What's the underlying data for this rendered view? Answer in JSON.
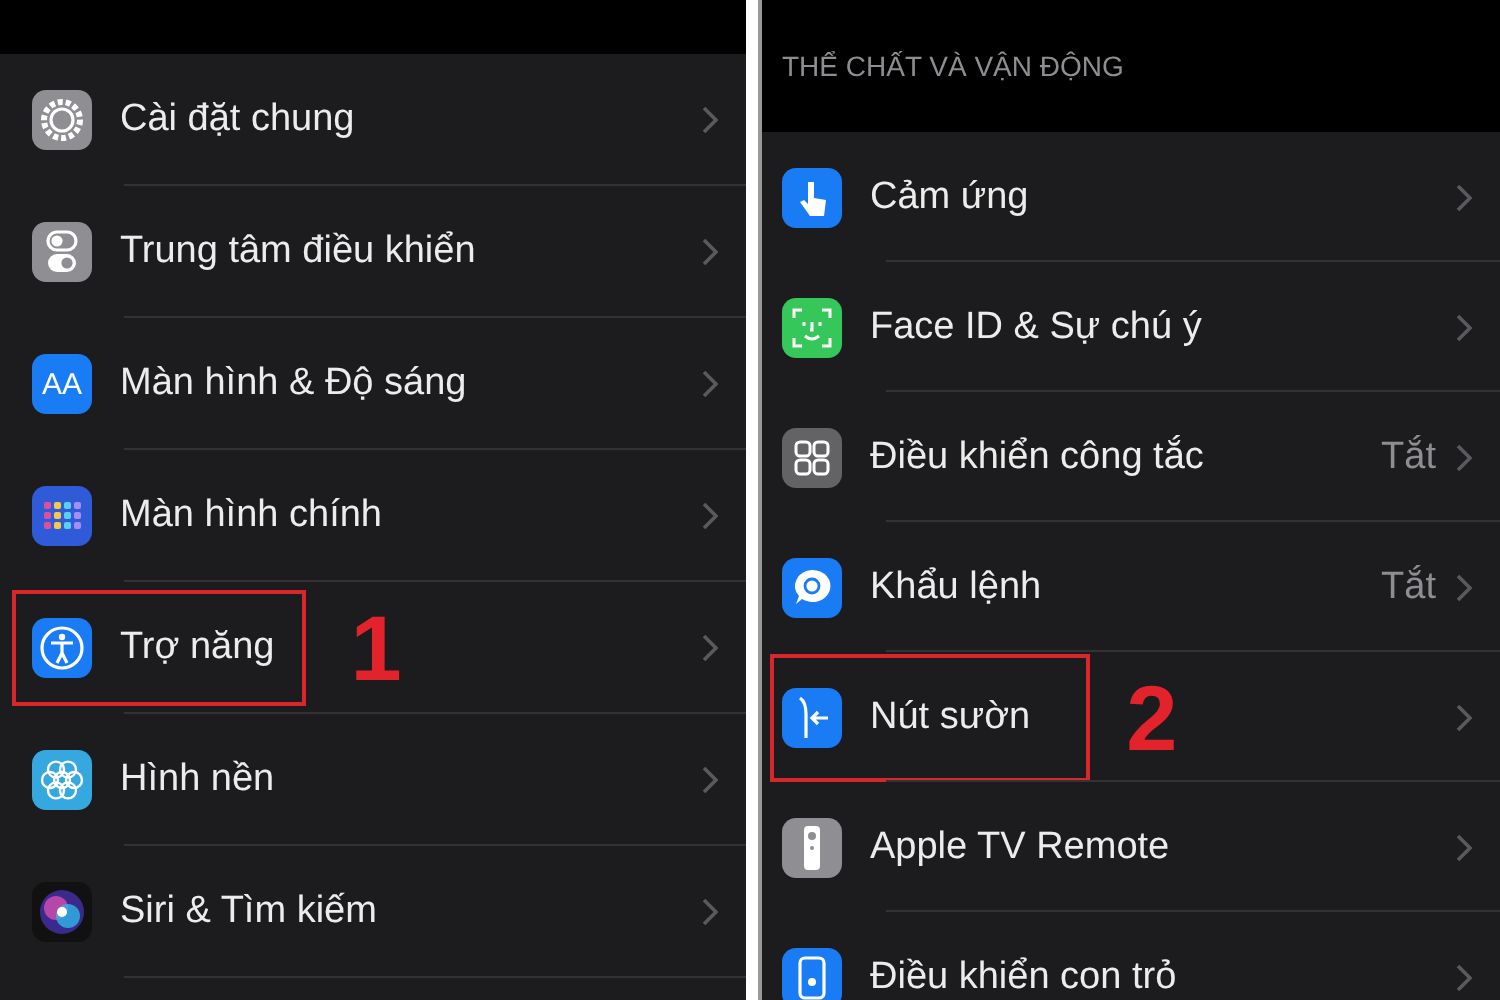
{
  "panels": [
    {
      "rows": [
        {
          "kind": "gear",
          "label": "Cài đặt chung",
          "highlighted": false
        },
        {
          "kind": "toggles",
          "label": "Trung tâm điều khiển",
          "highlighted": false
        },
        {
          "kind": "display",
          "icon_text": "AA",
          "label": "Màn hình & Độ sáng",
          "highlighted": false
        },
        {
          "kind": "grid",
          "label": "Màn hình chính",
          "highlighted": false
        },
        {
          "kind": "accessibility",
          "label": "Trợ năng",
          "highlighted": true,
          "marker": "1"
        },
        {
          "kind": "flower",
          "label": "Hình nền",
          "highlighted": false
        },
        {
          "kind": "orb",
          "label": "Siri & Tìm kiếm",
          "highlighted": false
        }
      ]
    },
    {
      "section_header": "THỂ CHẤT VÀ VẬN ĐỘNG",
      "rows": [
        {
          "kind": "hand",
          "label": "Cảm ứng",
          "highlighted": false
        },
        {
          "kind": "face",
          "label": "Face ID & Sự chú ý",
          "highlighted": false
        },
        {
          "kind": "squares",
          "label": "Điều khiển công tắc",
          "value": "Tắt",
          "highlighted": false
        },
        {
          "kind": "bubble",
          "label": "Khẩu lệnh",
          "value": "Tắt",
          "highlighted": false
        },
        {
          "kind": "side",
          "label": "Nút sườn",
          "highlighted": true,
          "marker": "2"
        },
        {
          "kind": "remote",
          "label": "Apple TV Remote",
          "highlighted": false
        },
        {
          "kind": "pointer",
          "label": "Điều khiển con trỏ",
          "highlighted": false
        }
      ]
    }
  ]
}
